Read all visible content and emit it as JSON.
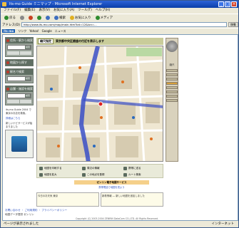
{
  "window": {
    "title": "Its-mo Guide ミニマップ - Microsoft Internet Explorer"
  },
  "menu": [
    "ファイル(F)",
    "編集(E)",
    "表示(V)",
    "お気に入り(A)",
    "ツール(T)",
    "ヘルプ(H)"
  ],
  "toolbar": {
    "back": "戻る",
    "search": "検索",
    "favorites": "お気に入り",
    "media": "メディア"
  },
  "address": {
    "label": "アドレス(D)",
    "url": "http://www.its-mo.com/map/main.htm?lat=12&lon=..."
  },
  "go_label": "移動",
  "links": {
    "brand": "its-mo",
    "items": [
      "リンク",
      "Yahoo!",
      "Google",
      "ニュース"
    ]
  },
  "left_panel": {
    "sections": [
      "住所・駅から検索",
      "地図から探す",
      "駅名で検索",
      "店舗・施設を検索"
    ],
    "search_button": "検索",
    "note": "its-mo Guide 2004 で東京のお店を検索。",
    "note_link": "詳細はこちら",
    "info": "新しいナビサービスが始まりました"
  },
  "map": {
    "tag": "縮尺指定",
    "title": "東京都中央区銀座の付近を表示します",
    "zoom_label": "縮尺"
  },
  "map_footer": {
    "items": [
      "地図を印刷する",
      "周辺の情報",
      "携帯に送る",
      "地図を拡大",
      "この地点を登録",
      "ルート検索"
    ]
  },
  "service": {
    "title": "ゼンリン電子地図サービス",
    "link": "携帯電話で地図を見よう"
  },
  "news": {
    "left": "今日のお天気 東京",
    "right": "新着情報 ― 新しい地図を追加しました"
  },
  "footer": {
    "line1": "お問い合わせ ・ ご利用規約 ・ プライバシーポリシー",
    "line2": "地図データ提供 ゼンリン",
    "copyright": "Copyright (C) 2003-2004 ZENRIN DataCom CO.,LTD. All Rights Reserved."
  },
  "status": {
    "left": "ページが表示されました",
    "right": "インターネット"
  },
  "colors": {
    "title_bar": "#0a3ea8",
    "route": "#3a4fc8",
    "map_bg": "#f0ead8"
  }
}
